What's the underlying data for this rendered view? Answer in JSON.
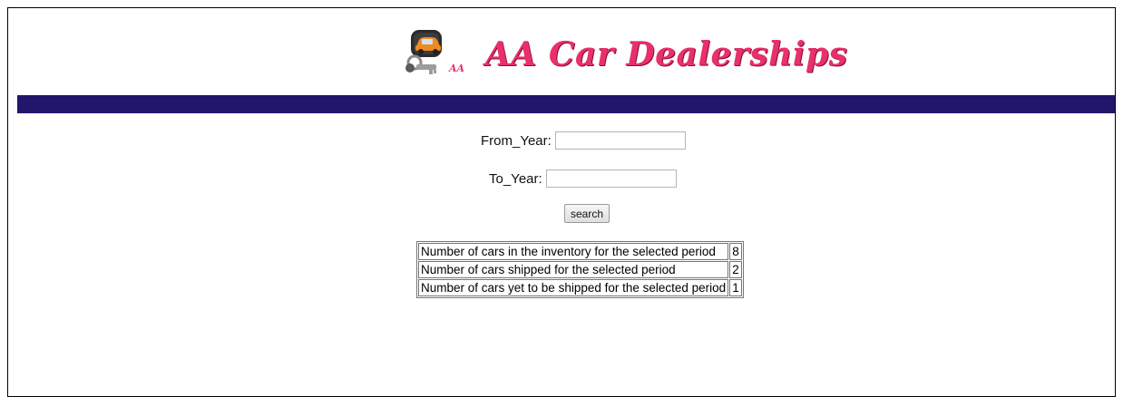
{
  "brand": {
    "title": "AA Car Dealerships",
    "logo_icon": "car-key-icon",
    "logo_text": "AA",
    "title_color": "#e8306b"
  },
  "nav_bar": {
    "color": "#21166b"
  },
  "form": {
    "from_year_label": "From_Year:",
    "from_year_value": "",
    "to_year_label": "To_Year:",
    "to_year_value": "",
    "search_label": "search"
  },
  "summary": {
    "rows": [
      {
        "label": "Number of cars in the inventory for the selected period",
        "value": "8"
      },
      {
        "label": "Number of cars shipped for the selected period",
        "value": "2"
      },
      {
        "label": "Number of cars yet to be shipped for the selected period",
        "value": "1"
      }
    ]
  }
}
